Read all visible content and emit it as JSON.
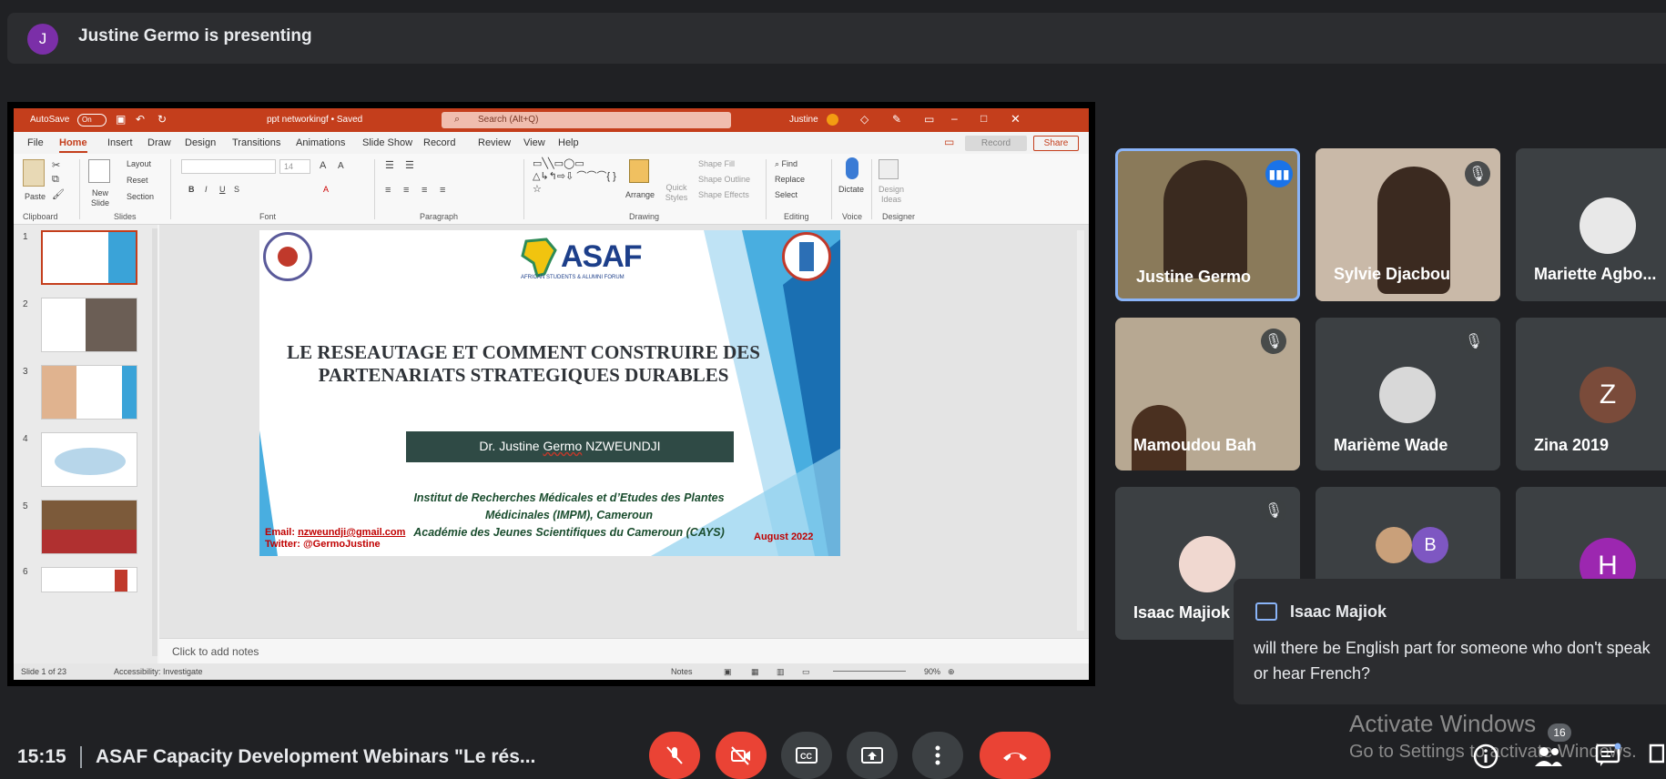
{
  "presenting": {
    "avatar_letter": "J",
    "text": "Justine Germo is presenting"
  },
  "ppt": {
    "autosave": "AutoSave",
    "toggle": "On",
    "filename": "ppt networkingf • Saved",
    "search": "Search (Alt+Q)",
    "user": "Justine",
    "menu": [
      "File",
      "Home",
      "Insert",
      "Draw",
      "Design",
      "Transitions",
      "Animations",
      "Slide Show",
      "Record",
      "Review",
      "View",
      "Help"
    ],
    "record_label": "Record",
    "share_label": "Share",
    "ribbon": {
      "paste": "Paste",
      "new_slide": "New Slide",
      "layout": "Layout",
      "reset": "Reset",
      "section": "Section",
      "font_size": "14",
      "arrange": "Arrange",
      "quick_styles": "Quick Styles",
      "shape_fill": "Shape Fill",
      "shape_outline": "Shape Outline",
      "shape_effects": "Shape Effects",
      "find": "Find",
      "replace": "Replace",
      "select": "Select",
      "dictate": "Dictate",
      "design_ideas": "Design Ideas",
      "groups": [
        "Clipboard",
        "Slides",
        "Font",
        "Paragraph",
        "Drawing",
        "Editing",
        "Voice",
        "Designer"
      ]
    },
    "thumb_numbers": [
      "1",
      "2",
      "3",
      "4",
      "5",
      "6"
    ],
    "slide": {
      "title": "LE RESEAUTAGE ET COMMENT CONSTRUIRE DES PARTENARIATS STRATEGIQUES DURABLES",
      "presenter_prefix": "Dr. Justine ",
      "presenter_middle": "Germo",
      "presenter_suffix": " NZWEUNDJI",
      "inst1": "Institut de Recherches Médicales et d’Etudes des Plantes",
      "inst2": "Médicinales (IMPM), Cameroun",
      "inst3": "Académie des Jeunes Scientifiques du Cameroun (CAYS)",
      "email_label": "Email: ",
      "email": "nzweundji@gmail.com",
      "twitter": "Twitter: @GermoJustine",
      "date": "August 2022",
      "logo_text": "ASAF",
      "logo_sub": "AFRICAN STUDENTS & ALUMNI FORUM"
    },
    "notes": "Click to add notes",
    "status": {
      "slide": "Slide 1 of 23",
      "accessibility": "Accessibility: Investigate",
      "notes": "Notes",
      "zoom": "90%"
    }
  },
  "participants": [
    {
      "name": "Justine Germo"
    },
    {
      "name": "Sylvie Djacbou"
    },
    {
      "name": "Mariette Agbo..."
    },
    {
      "name": "Mamoudou Bah"
    },
    {
      "name": "Marième Wade"
    },
    {
      "name": "Zina 2019",
      "letter": "Z"
    },
    {
      "name": "Isaac Majiok"
    },
    {
      "letter": "B"
    },
    {
      "letter": "H"
    }
  ],
  "chat": {
    "sender": "Isaac Majiok",
    "message": "will there be English part for someone who don't speak or hear French?"
  },
  "watermark": {
    "line1": "Activate Windows",
    "line2": "Go to Settings to activate Windows."
  },
  "footer": {
    "time": "15:15",
    "meeting": "ASAF Capacity Development Webinars \"Le rés...",
    "people_count": "16"
  },
  "colors": {
    "meet_bg": "#202124",
    "ppt_accent": "#c43e1c",
    "end_call": "#ea4335",
    "speaking": "#8ab4f8"
  }
}
